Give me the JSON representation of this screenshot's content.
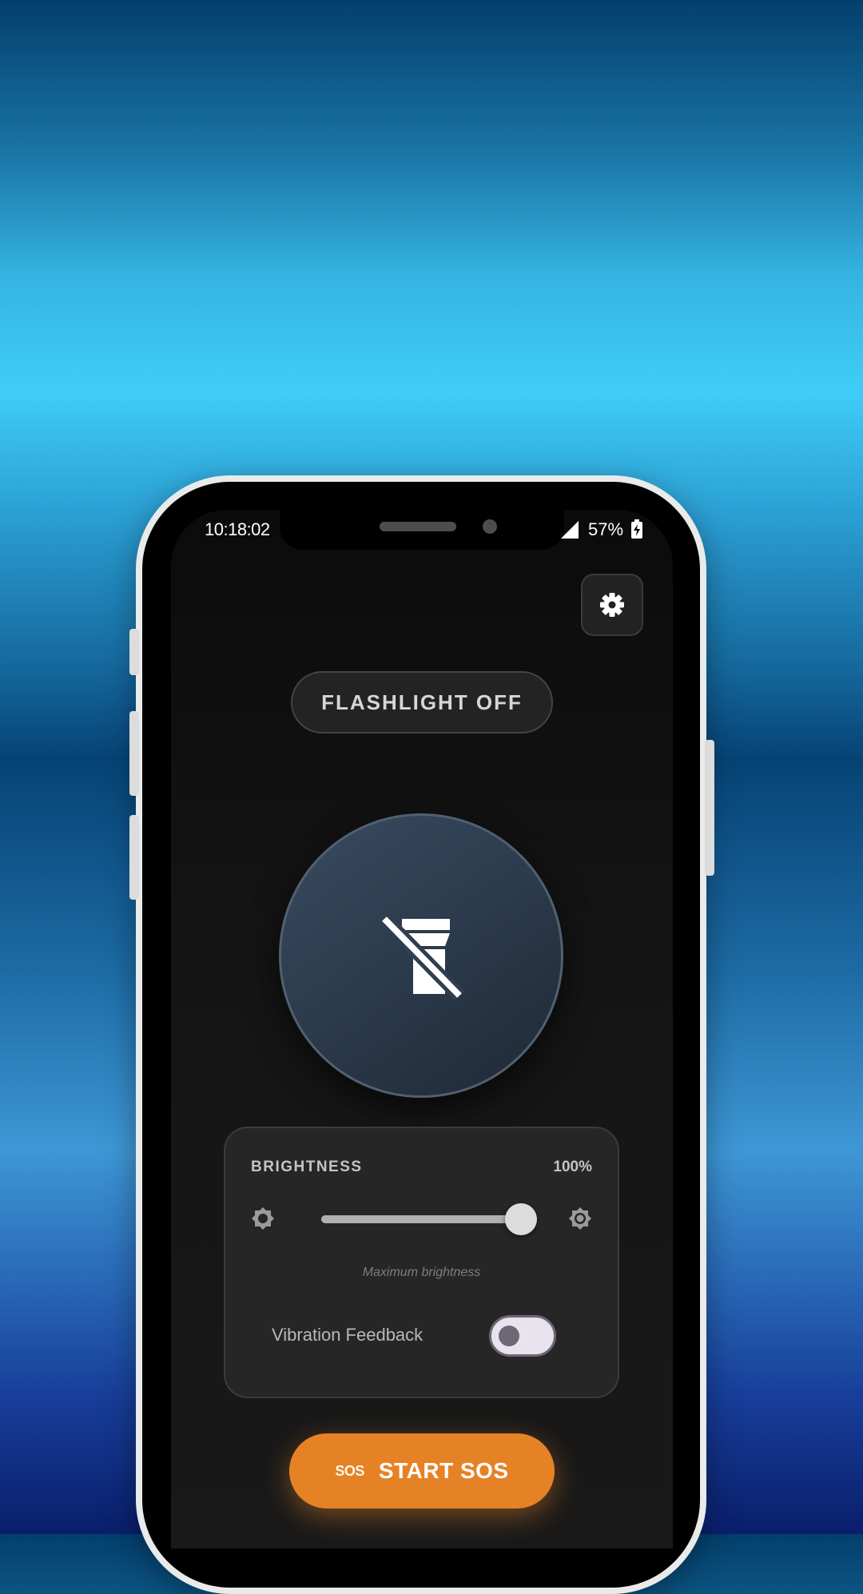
{
  "status_bar": {
    "time": "10:18:02",
    "battery_percent": "57%",
    "signal_icon": "cell-signal-icon",
    "battery_icon": "battery-charging-icon"
  },
  "settings": {
    "icon": "gear-icon"
  },
  "flashlight": {
    "status_label": "FLASHLIGHT OFF",
    "power_icon": "flashlight-off-icon"
  },
  "brightness": {
    "label": "BRIGHTNESS",
    "value_text": "100%",
    "value": 100,
    "hint": "Maximum brightness",
    "low_icon": "brightness-low-icon",
    "high_icon": "brightness-high-icon"
  },
  "vibration": {
    "label": "Vibration Feedback",
    "enabled": false
  },
  "sos": {
    "icon_text": "SOS",
    "label": "START SOS"
  },
  "colors": {
    "accent": "#e68226",
    "power_circle": "#2b3a4c",
    "screen_background": "#141414"
  }
}
